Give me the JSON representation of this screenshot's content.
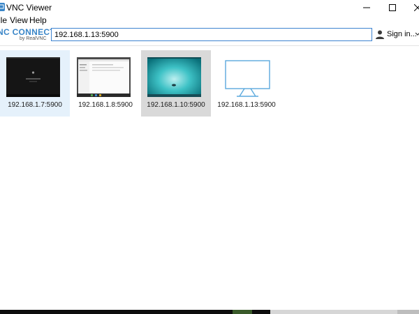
{
  "window": {
    "title": "VNC Viewer",
    "icon": "vnc-viewer-app-icon",
    "controls": [
      "minimize-icon",
      "maximize-icon",
      "close-icon"
    ]
  },
  "menu": {
    "file": "ile",
    "view": "View",
    "help": "Help"
  },
  "toolbar": {
    "logo_main": "NC CONNECT",
    "logo_sub": "by RealVNC",
    "address_value": "192.168.1.13:5900",
    "signin_label": "Sign in..."
  },
  "connections": [
    {
      "label": "192.168.1.7:5900",
      "state": "selected",
      "thumbnail": "dark-desktop"
    },
    {
      "label": "192.168.1.8:5900",
      "state": "normal",
      "thumbnail": "light-window-desktop"
    },
    {
      "label": "192.168.1.10:5900",
      "state": "hovered",
      "thumbnail": "teal-desktop"
    },
    {
      "label": "192.168.1.13:5900",
      "state": "normal",
      "thumbnail": "monitor-placeholder-icon"
    }
  ],
  "colors": {
    "brand": "#3a86c8",
    "selected_tile": "#e5f1fb",
    "hovered_tile": "#d9d9d9",
    "input_border": "#3d83d0"
  }
}
